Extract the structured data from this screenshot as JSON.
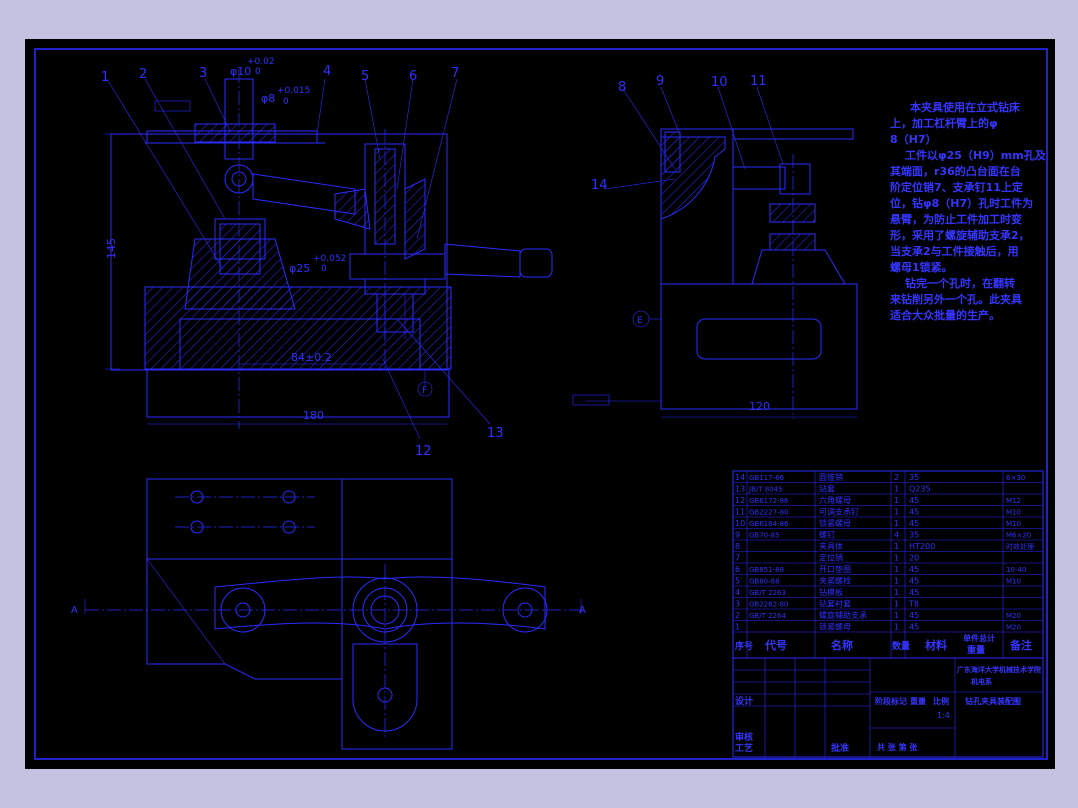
{
  "callouts": [
    "1",
    "2",
    "3",
    "4",
    "5",
    "6",
    "7",
    "8",
    "9",
    "10",
    "11",
    "12",
    "13",
    "14"
  ],
  "dims": {
    "d10": "φ10",
    "d10_tol_up": "+0.02",
    "d10_tol_lo": "0",
    "d8": "φ8",
    "d8_tol_up": "+0.015",
    "d8_tol_lo": "0",
    "d25": "φ25",
    "d25_tol_up": "+0.052",
    "d25_tol_lo": "0",
    "height_145": "145",
    "len_84": "84±0.2",
    "len_180": "180",
    "len_120": "120",
    "datum_e": "E",
    "datum_f": "F",
    "section_a": "A"
  },
  "notes": [
    "本夹具使用在立式钻床",
    "上，加工杠杆臂上的φ",
    "8（H7）",
    "工件以φ25（H9）mm孔及",
    "其端面，r36的凸台面在台",
    "阶定位销7、支承钉11上定",
    "位，钻φ8（H7）孔时工件为",
    "悬臂，为防止工件加工时变",
    "形，采用了螺旋辅助支承2，",
    "当支承2与工件接触后，用",
    "螺母1锁紧。",
    "钻完一个孔时，在翻转",
    "来钻削另外一个孔。此夹具",
    "适合大众批量的生产。"
  ],
  "bom": {
    "header": {
      "no": "序号",
      "code": "代号",
      "name": "名称",
      "qty": "数量",
      "material": "材料",
      "unit_total": "单件总计",
      "weight": "重量",
      "remark": "备注"
    },
    "rows": [
      {
        "no": "14",
        "code": "GB117-86",
        "name": "圆锥销",
        "qty": "2",
        "material": "35",
        "remark": "6×30"
      },
      {
        "no": "13",
        "code": "JB/T 8045",
        "name": "钻套",
        "qty": "1",
        "material": "Q235",
        "remark": ""
      },
      {
        "no": "12",
        "code": "GB6172-86",
        "name": "六角螺母",
        "qty": "1",
        "material": "45",
        "remark": "M12"
      },
      {
        "no": "11",
        "code": "GB2227-80",
        "name": "可调支承钉",
        "qty": "1",
        "material": "45",
        "remark": "M10"
      },
      {
        "no": "10",
        "code": "GB6184-86",
        "name": "锁紧螺母",
        "qty": "1",
        "material": "45",
        "remark": "M10"
      },
      {
        "no": "9",
        "code": "GB70-85",
        "name": "螺钉",
        "qty": "4",
        "material": "35",
        "remark": "M6×20"
      },
      {
        "no": "8",
        "code": "",
        "name": "夹具体",
        "qty": "1",
        "material": "HT200",
        "remark": "时效处理"
      },
      {
        "no": "7",
        "code": "",
        "name": "定位销",
        "qty": "1",
        "material": "20",
        "remark": ""
      },
      {
        "no": "6",
        "code": "GB851-88",
        "name": "开口垫圈",
        "qty": "1",
        "material": "45",
        "remark": "10-40"
      },
      {
        "no": "5",
        "code": "GB80-88",
        "name": "夹紧螺栓",
        "qty": "1",
        "material": "45",
        "remark": "M10"
      },
      {
        "no": "4",
        "code": "GB/T 2263",
        "name": "钻模板",
        "qty": "1",
        "material": "45",
        "remark": ""
      },
      {
        "no": "3",
        "code": "GB2262-80",
        "name": "钻套衬套",
        "qty": "1",
        "material": "T8",
        "remark": ""
      },
      {
        "no": "2",
        "code": "GB/T 2264",
        "name": "螺旋辅助支承",
        "qty": "1",
        "material": "45",
        "remark": "M20"
      },
      {
        "no": "1",
        "code": "",
        "name": "锁紧螺母",
        "qty": "1",
        "material": "45",
        "remark": "M20"
      }
    ]
  },
  "titleblock": {
    "school": "广东海洋大学机械技术学院",
    "dept": "机电系",
    "design": "设计",
    "review": "审核",
    "process": "工艺",
    "approve": "批准",
    "stage_mark": "阶段标记",
    "weight": "重量",
    "scale": "比例",
    "scale_value": "1:4",
    "drawing_name": "钻孔夹具装配图",
    "sheet": "共 张 第 张"
  }
}
